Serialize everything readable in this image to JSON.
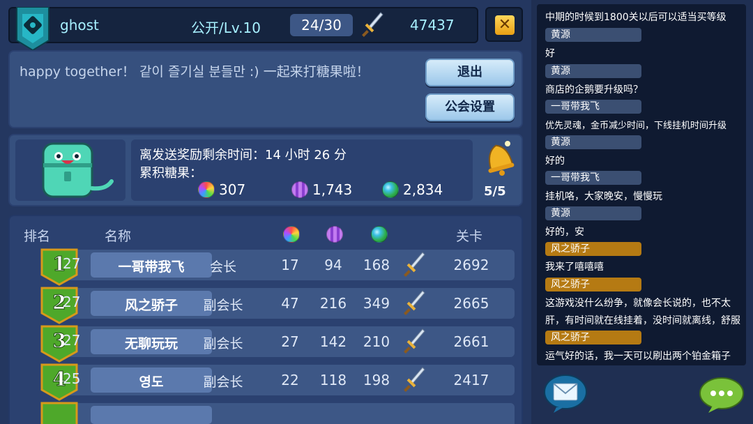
{
  "header": {
    "guild_name": "ghost",
    "guild_level": "公开/Lv.10",
    "members": "24/30",
    "score": "47437",
    "close_label": "✕"
  },
  "notice": {
    "text": "happy together！ 같이 즐기실 분들만 :) 一起来打糖果啦！",
    "exit_label": "退出",
    "settings_label": "公会设置"
  },
  "reward": {
    "timer_text": "离发送奖励剩余时间：14 小时 26 分",
    "candy_label": "累积糖果：",
    "candies": [
      {
        "icon": "rainbow-candy-icon",
        "value": "307"
      },
      {
        "icon": "purple-candy-icon",
        "value": "1,743"
      },
      {
        "icon": "green-candy-icon",
        "value": "2,834"
      }
    ],
    "bell_count": "5/5"
  },
  "table": {
    "headers": {
      "rank": "排名",
      "name": "名称",
      "stage": "关卡"
    },
    "rows": [
      {
        "rank": "1",
        "level": "27",
        "name": "一哥带我飞",
        "role": "会长",
        "c1": "17",
        "c2": "94",
        "c3": "168",
        "stage": "2692"
      },
      {
        "rank": "2",
        "level": "27",
        "name": "风之骄子",
        "role": "副会长",
        "c1": "47",
        "c2": "216",
        "c3": "349",
        "stage": "2665"
      },
      {
        "rank": "3",
        "level": "27",
        "name": "无聊玩玩",
        "role": "副会长",
        "c1": "27",
        "c2": "142",
        "c3": "210",
        "stage": "2661"
      },
      {
        "rank": "4",
        "level": "25",
        "name": "영도",
        "role": "副会长",
        "c1": "22",
        "c2": "118",
        "c3": "198",
        "stage": "2417"
      }
    ]
  },
  "chat": {
    "messages": [
      {
        "type": "text",
        "text": "中期的时候到1800关以后可以适当买等级"
      },
      {
        "type": "name",
        "color": "blue",
        "text": "黄源"
      },
      {
        "type": "text",
        "text": "好"
      },
      {
        "type": "name",
        "color": "blue",
        "text": "黄源"
      },
      {
        "type": "text",
        "text": "商店的企鹅要升级吗？"
      },
      {
        "type": "name",
        "color": "blue",
        "text": "一哥带我飞"
      },
      {
        "type": "text",
        "small": true,
        "text": "优先灵魂，金币减少时间，下线挂机时间升级"
      },
      {
        "type": "name",
        "color": "blue",
        "text": "黄源"
      },
      {
        "type": "text",
        "text": "好的"
      },
      {
        "type": "name",
        "color": "blue",
        "text": "一哥带我飞"
      },
      {
        "type": "text",
        "text": "挂机咯，大家晚安，慢慢玩"
      },
      {
        "type": "name",
        "color": "blue",
        "text": "黄源"
      },
      {
        "type": "text",
        "text": "好的，安"
      },
      {
        "type": "name",
        "color": "gold",
        "text": "风之骄子"
      },
      {
        "type": "text",
        "text": "我来了嘻嘻嘻"
      },
      {
        "type": "name",
        "color": "gold",
        "text": "风之骄子"
      },
      {
        "type": "text",
        "text": "这游戏没什么纷争，就像会长说的，也不太"
      },
      {
        "type": "text",
        "text": "肝，有时间就在线挂着，没时间就离线，舒服"
      },
      {
        "type": "name",
        "color": "gold",
        "text": "风之骄子"
      },
      {
        "type": "text",
        "text": "运气好的话，我一天可以刷出两个铂金箱子"
      }
    ]
  },
  "colors": {
    "accent_gold": "#b57a13",
    "panel": "#36507e",
    "badge_green": "#4ea82a"
  }
}
